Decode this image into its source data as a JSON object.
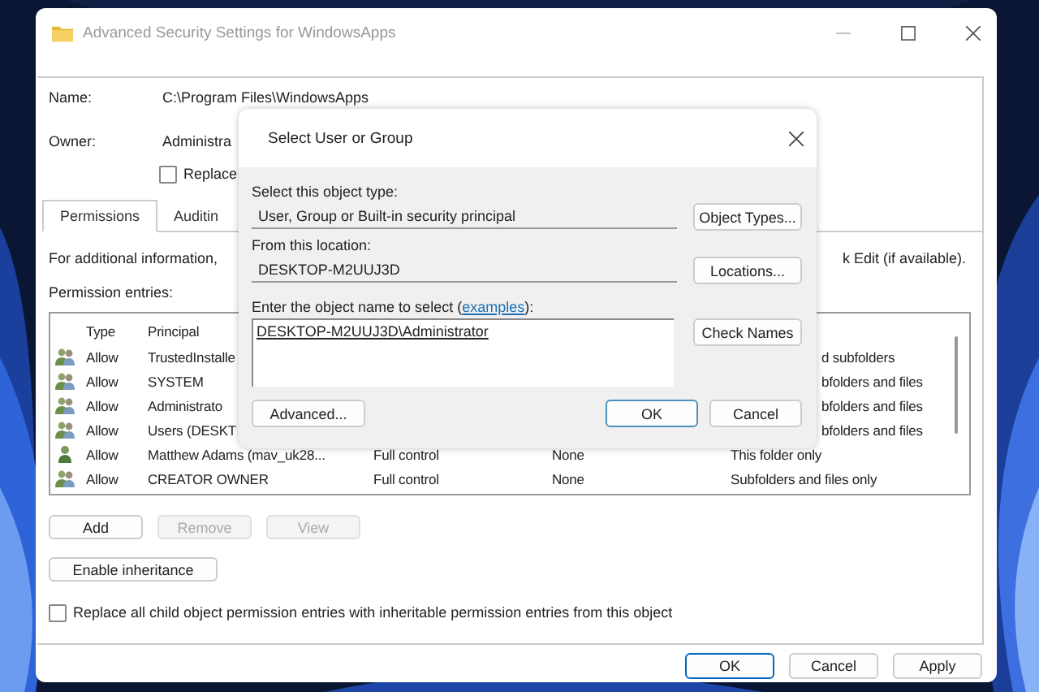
{
  "window": {
    "title": "Advanced Security Settings for WindowsApps"
  },
  "name": {
    "label": "Name:",
    "value": "C:\\Program Files\\WindowsApps"
  },
  "owner": {
    "label": "Owner:",
    "value": "Administra"
  },
  "replace_owner": {
    "label": "Replace",
    "checked": false
  },
  "tabs": [
    {
      "label": "Permissions",
      "selected": true
    },
    {
      "label": "Auditin",
      "selected": false
    }
  ],
  "info": {
    "left": "For additional information,",
    "right": "k Edit (if available)."
  },
  "entries_label": "Permission entries:",
  "table": {
    "columns": [
      "Type",
      "Principal"
    ],
    "rows": [
      {
        "kind": "group",
        "type": "Allow",
        "principal": "TrustedInstalle",
        "applies": "d subfolders"
      },
      {
        "kind": "group",
        "type": "Allow",
        "principal": "SYSTEM",
        "applies": "bfolders and files"
      },
      {
        "kind": "group",
        "type": "Allow",
        "principal": "Administrato",
        "applies": "bfolders and files"
      },
      {
        "kind": "group",
        "type": "Allow",
        "principal": "Users (DESKT",
        "applies": "bfolders and files"
      },
      {
        "kind": "user",
        "type": "Allow",
        "principal": "Matthew Adams (mav_uk28...",
        "access": "Full control",
        "inherited": "None",
        "applies": "This folder only"
      },
      {
        "kind": "group",
        "type": "Allow",
        "principal": "CREATOR OWNER",
        "access": "Full control",
        "inherited": "None",
        "applies": "Subfolders and files only"
      }
    ]
  },
  "entry_buttons": [
    {
      "label": "Add",
      "disabled": false
    },
    {
      "label": "Remove",
      "disabled": true
    },
    {
      "label": "View",
      "disabled": true
    }
  ],
  "enable_inheritance": "Enable inheritance",
  "replace_child": {
    "label": "Replace all child object permission entries with inheritable permission entries from this object",
    "checked": false
  },
  "footer_buttons": [
    {
      "label": "OK",
      "default": true
    },
    {
      "label": "Cancel",
      "default": false
    },
    {
      "label": "Apply",
      "default": false
    }
  ],
  "dialog": {
    "title": "Select User or Group",
    "object_type_label": "Select this object type:",
    "object_type": "User, Group or Built-in security principal",
    "object_types_button": "Object Types...",
    "location_label": "From this location:",
    "location": "DESKTOP-M2UUJ3D",
    "locations_button": "Locations...",
    "object_name_label": {
      "before": "Enter the object name to select (",
      "link": "examples",
      "after": "):"
    },
    "object_name": "DESKTOP-M2UUJ3D\\Administrator",
    "check_names_button": "Check Names",
    "advanced_button": "Advanced...",
    "buttons": [
      {
        "label": "OK",
        "default": true
      },
      {
        "label": "Cancel",
        "default": false
      }
    ]
  }
}
